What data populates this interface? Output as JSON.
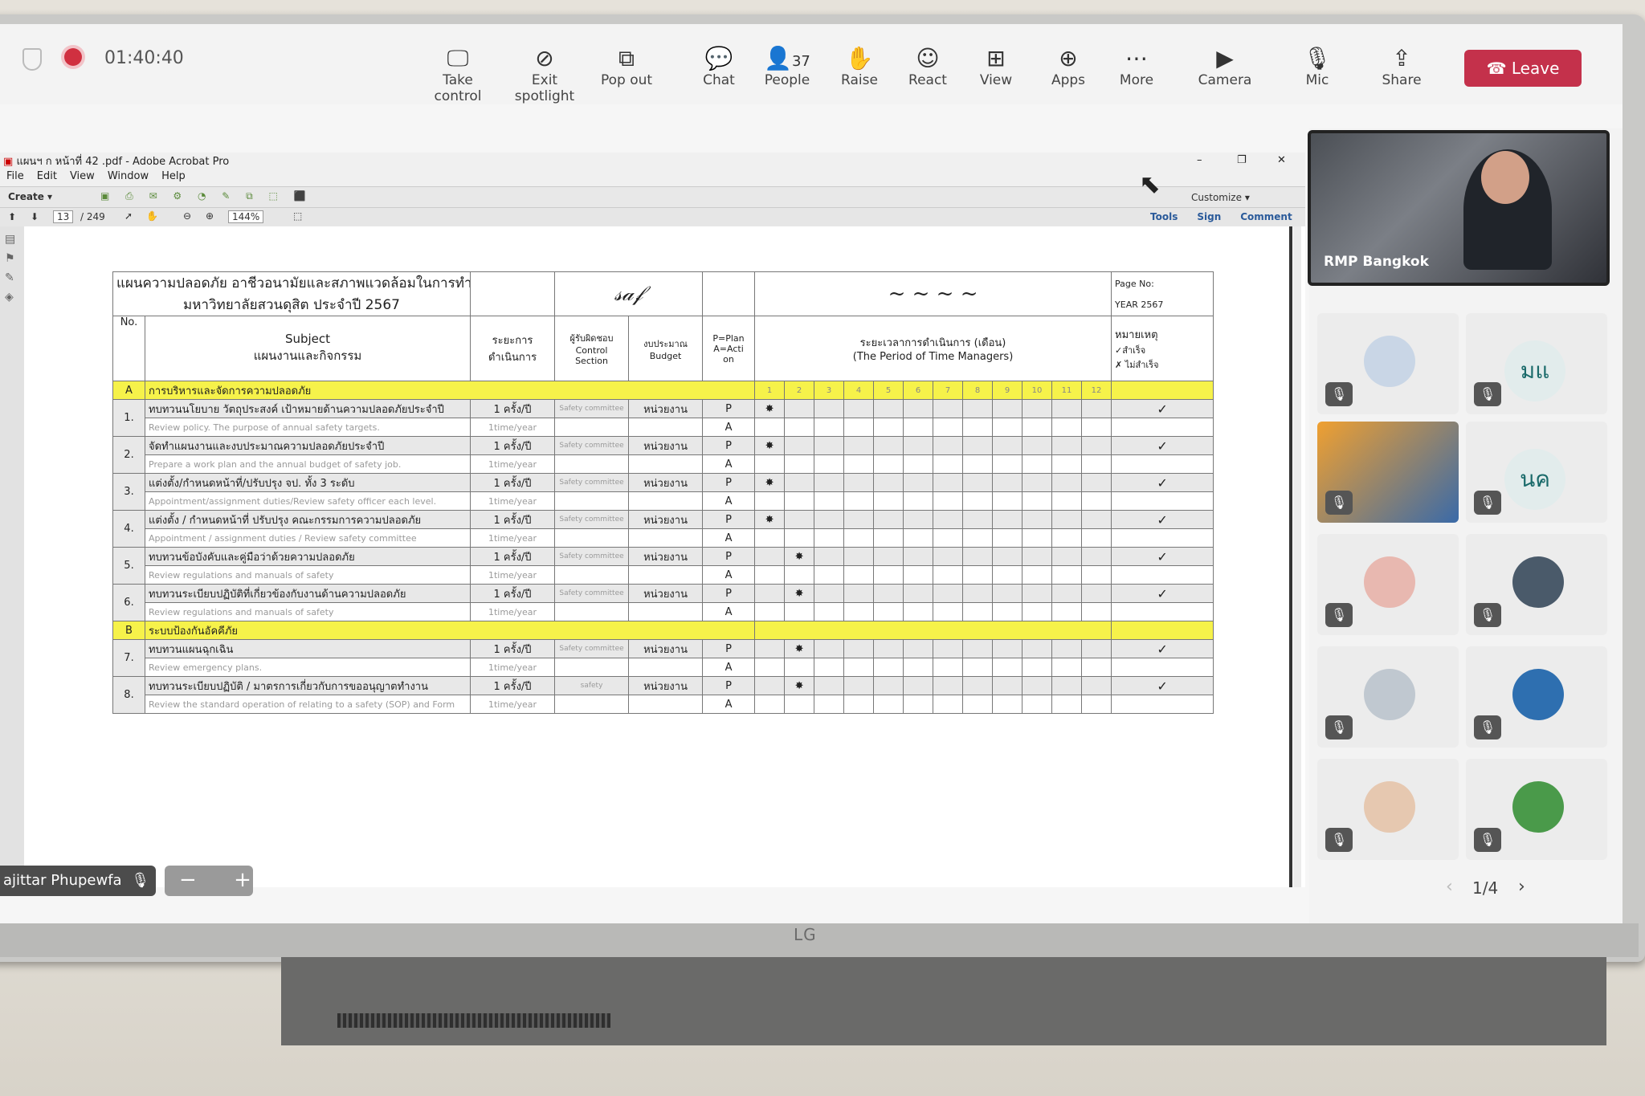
{
  "toolbar": {
    "timer": "01:40:40",
    "buttons": [
      {
        "label": "Take control",
        "icon": "take-control-icon"
      },
      {
        "label": "Exit spotlight",
        "icon": "exit-spotlight-icon"
      },
      {
        "label": "Pop out",
        "icon": "pop-out-icon"
      },
      {
        "label": "Chat",
        "icon": "chat-icon"
      },
      {
        "label": "People",
        "icon": "people-icon",
        "count": "37"
      },
      {
        "label": "Raise",
        "icon": "raise-hand-icon"
      },
      {
        "label": "React",
        "icon": "react-icon"
      },
      {
        "label": "View",
        "icon": "view-icon"
      },
      {
        "label": "Apps",
        "icon": "apps-icon"
      },
      {
        "label": "More",
        "icon": "more-icon"
      },
      {
        "label": "Camera",
        "icon": "camera-icon"
      },
      {
        "label": "Mic",
        "icon": "mic-icon"
      },
      {
        "label": "Share",
        "icon": "share-icon"
      }
    ],
    "leave": "Leave",
    "leave_color": "#c4314b"
  },
  "acrobat": {
    "title": "แผนฯ ก หน้าที่ 42 .pdf - Adobe Acrobat Pro",
    "menu": [
      "File",
      "Edit",
      "View",
      "Window",
      "Help"
    ],
    "create": "Create",
    "page": "13",
    "pages": "/ 249",
    "zoom": "144%",
    "customize": "Customize",
    "right_tabs": [
      "Tools",
      "Sign",
      "Comment"
    ]
  },
  "pdf": {
    "title_line1": "แผนความปลอดภัย อาชีวอนามัยและสภาพแวดล้อมในการทำงาน",
    "title_line2": "มหาวิทยาลัยสวนดุสิต ประจำปี 2567",
    "page_no": "Page No:",
    "year": "YEAR 2567",
    "headers": {
      "no": "No.",
      "subject": "Subject",
      "subject_th": "แผนงานและกิจกรรม",
      "period": "ระยะการ",
      "period2": "ดำเนินการ",
      "resp": "ผู้รับผิดชอบ",
      "resp2": "Control",
      "resp3": "Section",
      "budget": "งบประมาณ",
      "budget2": "Budget",
      "plan": "P=Plan",
      "plan2": "A=Acti",
      "plan3": "on",
      "timeline": "ระยะเวลาการดำเนินการ (เดือน)",
      "timeline2": "(The Period of Time Managers)",
      "note": "หมายเหตุ",
      "note2": "✓สำเร็จ",
      "note3": "✗ ไม่สำเร็จ"
    },
    "months": [
      "1",
      "2",
      "3",
      "4",
      "5",
      "6",
      "7",
      "8",
      "9",
      "10",
      "11",
      "12"
    ],
    "sections": [
      {
        "code": "A",
        "title": "การบริหารและจัดการความปลอดภัย"
      },
      {
        "code": "B",
        "title": "ระบบป้องกันอัคคีภัย"
      }
    ],
    "rows": [
      {
        "no": "1.",
        "th": "ทบทวนนโยบาย วัตถุประสงค์ เป้าหมายด้านความปลอดภัยประจำปี",
        "en": "Review policy. The purpose of annual safety targets.",
        "freq": "1 ครั้ง/ปี",
        "freq_en": "1time/year",
        "resp": "Safety committee",
        "budget": "หน่วยงาน",
        "month": 1,
        "check": "✓"
      },
      {
        "no": "2.",
        "th": "จัดทำแผนงานและงบประมาณความปลอดภัยประจำปี",
        "en": "Prepare a work plan and the annual budget of safety job.",
        "freq": "1 ครั้ง/ปี",
        "freq_en": "1time/year",
        "resp": "Safety committee",
        "budget": "หน่วยงาน",
        "month": 1,
        "check": "✓"
      },
      {
        "no": "3.",
        "th": "แต่งตั้ง/กำหนดหน้าที่/ปรับปรุง จป. ทั้ง 3 ระดับ",
        "en": "Appointment/assignment duties/Review safety officer each level.",
        "freq": "1 ครั้ง/ปี",
        "freq_en": "1time/year",
        "resp": "Safety committee",
        "budget": "หน่วยงาน",
        "month": 1,
        "check": "✓"
      },
      {
        "no": "4.",
        "th": "แต่งตั้ง / กำหนดหน้าที่ ปรับปรุง คณะกรรมการความปลอดภัย",
        "en": "Appointment / assignment duties / Review safety committee",
        "freq": "1 ครั้ง/ปี",
        "freq_en": "1time/year",
        "resp": "Safety committee",
        "budget": "หน่วยงาน",
        "month": 1,
        "check": "✓"
      },
      {
        "no": "5.",
        "th": "ทบทวนข้อบังคับและคู่มือว่าด้วยความปลอดภัย",
        "en": "Review regulations and manuals of safety",
        "freq": "1 ครั้ง/ปี",
        "freq_en": "1time/year",
        "resp": "Safety committee",
        "budget": "หน่วยงาน",
        "month": 2,
        "check": "✓"
      },
      {
        "no": "6.",
        "th": "ทบทวนระเบียบปฏิบัติที่เกี่ยวข้องกับงานด้านความปลอดภัย",
        "en": "Review regulations and manuals of safety",
        "freq": "1 ครั้ง/ปี",
        "freq_en": "1time/year",
        "resp": "Safety committee",
        "budget": "หน่วยงาน",
        "month": 2,
        "check": "✓"
      },
      {
        "section": 1
      },
      {
        "no": "7.",
        "th": "ทบทวนแผนฉุกเฉิน",
        "en": "Review emergency plans.",
        "freq": "1 ครั้ง/ปี",
        "freq_en": "1time/year",
        "resp": "Safety committee",
        "budget": "หน่วยงาน",
        "month": 2,
        "check": "✓"
      },
      {
        "no": "8.",
        "th": "ทบทวนระเบียบปฏิบัติ / มาตรการเกี่ยวกับการขออนุญาตทำงาน",
        "en": "Review the standard operation of relating to a safety (SOP) and Form",
        "freq": "1 ครั้ง/ปี",
        "freq_en": "1time/year",
        "resp": "safety",
        "budget": "หน่วยงาน",
        "month": 2,
        "check": "✓"
      }
    ]
  },
  "gallery": {
    "spotlight_name": "RMP Bangkok",
    "tiles": [
      {
        "kind": "photo",
        "color": "#c9d6e6"
      },
      {
        "kind": "initials",
        "text": "มแ"
      },
      {
        "kind": "room",
        "color": "#f0a030"
      },
      {
        "kind": "initials",
        "text": "นค"
      },
      {
        "kind": "photo",
        "color": "#e8b8b0"
      },
      {
        "kind": "photo",
        "color": "#4a5a6a"
      },
      {
        "kind": "photo",
        "color": "#c0c8d0"
      },
      {
        "kind": "photo",
        "color": "#2e6fb0"
      },
      {
        "kind": "photo",
        "color": "#e6c8b0"
      },
      {
        "kind": "photo",
        "color": "#4a9a4a"
      }
    ],
    "pager": "1/4"
  },
  "self_view": {
    "name": "ajittar Phupewfa"
  },
  "brand": "LG"
}
